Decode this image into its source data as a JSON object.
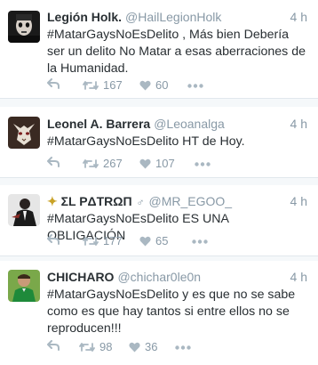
{
  "tweets": [
    {
      "name": "Legión Holk.",
      "handle": "@HailLegionHolk",
      "time": "4 h",
      "text": "#MatarGaysNoEsDelito , Más bien Debería ser un delito No Matar a esas aberraciones de la Humanidad.",
      "retweets": "167",
      "likes": "60",
      "avatar_icon": "dark-face-avatar-icon"
    },
    {
      "name": "Leonel A. Barrera",
      "handle": "@Leoanalga",
      "time": "4 h",
      "text": "#MatarGaysNoEsDelito HT de Hoy.",
      "retweets": "267",
      "likes": "107",
      "avatar_icon": "masked-figure-avatar-icon"
    },
    {
      "name_prefix": "✦",
      "name": "ΣL PΔTRΩΠ",
      "name_suffix": "♂",
      "handle": "@MR_EGOO_",
      "time": "4 h",
      "text": "#MatarGaysNoEsDelito ES UNA OBLIGACIÓN",
      "retweets": "177",
      "likes": "65",
      "avatar_icon": "suit-figure-avatar-icon"
    },
    {
      "name": "CHICHARO",
      "handle": "@chichar0le0n",
      "time": "4 h",
      "text": "#MatarGaysNoEsDelito y es que no se sabe como es que hay tantos si entre ellos no se reproducen!!!",
      "retweets": "98",
      "likes": "36",
      "avatar_icon": "soccer-player-avatar-icon"
    }
  ],
  "colors": {
    "background": "#f5f8fa",
    "text": "#292f33",
    "secondary": "#8899a6",
    "icon": "#aab8c2",
    "divider": "#e1e8ed"
  }
}
